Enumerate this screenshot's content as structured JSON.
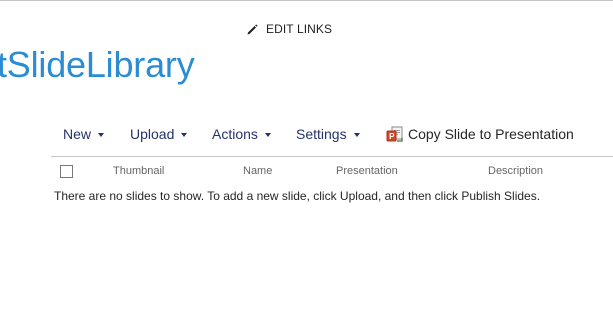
{
  "edit_links": {
    "label": "EDIT LINKS",
    "icon": "pencil-icon"
  },
  "site": {
    "title": "tSlideLibrary",
    "title_color": "#2a8dd4"
  },
  "toolbar": {
    "new_label": "New",
    "upload_label": "Upload",
    "actions_label": "Actions",
    "settings_label": "Settings",
    "copy_label": "Copy Slide to Presentation",
    "copy_icon": "copy-to-presentation-icon",
    "link_color": "#26326b"
  },
  "list": {
    "columns": [
      "Thumbnail",
      "Name",
      "Presentation",
      "Description"
    ],
    "empty_message": "There are no slides to show. To add a new slide, click Upload, and then click Publish Slides."
  }
}
